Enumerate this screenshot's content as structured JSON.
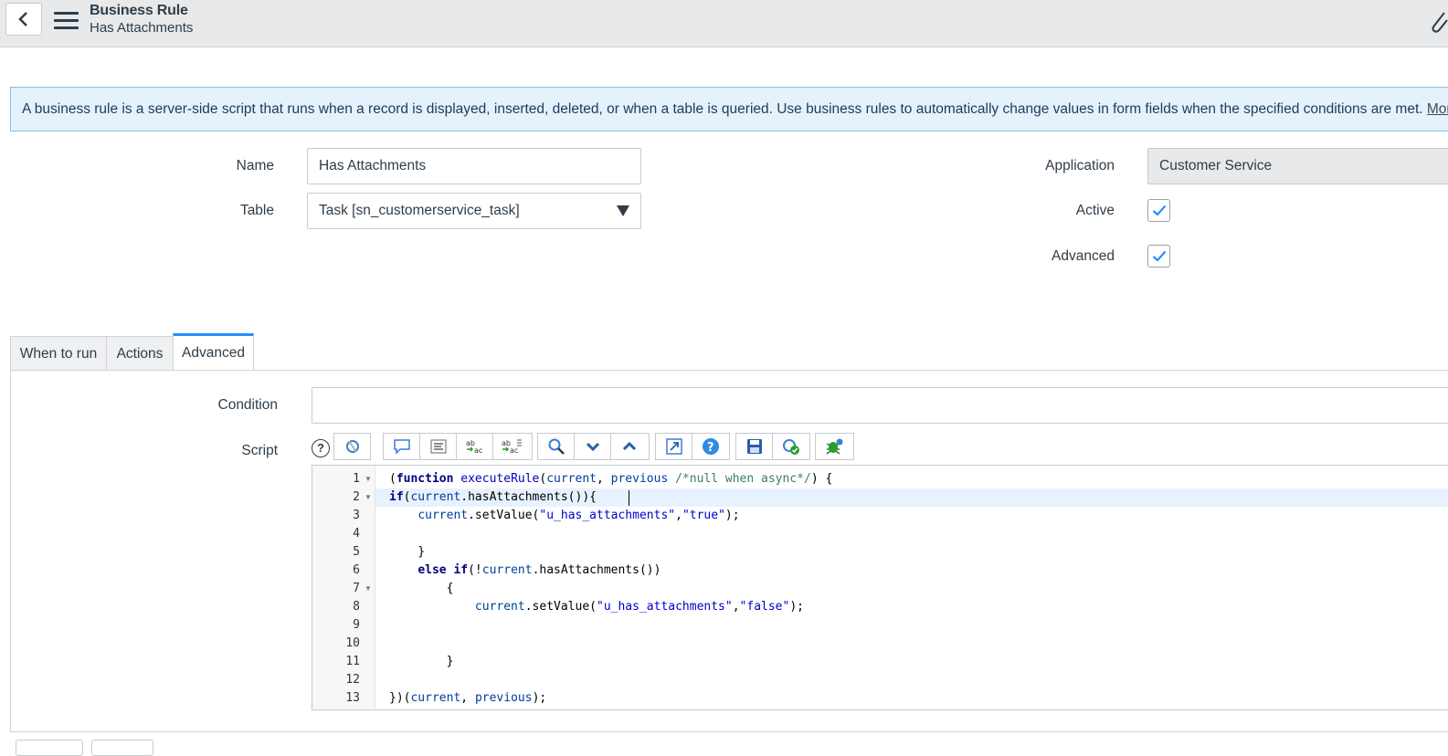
{
  "header": {
    "title": "Business Rule",
    "subtitle": "Has Attachments"
  },
  "info": {
    "text": "A business rule is a server-side script that runs when a record is displayed, inserted, deleted, or when a table is queried. Use business rules to automatically change values in form fields when the specified conditions are met. ",
    "link": "More Info"
  },
  "form": {
    "name_label": "Name",
    "name_value": "Has Attachments",
    "table_label": "Table",
    "table_value": "Task [sn_customerservice_task]",
    "application_label": "Application",
    "application_value": "Customer Service",
    "active_label": "Active",
    "active_checked": true,
    "advanced_label": "Advanced",
    "advanced_checked": true
  },
  "tabs": [
    {
      "label": "When to run"
    },
    {
      "label": "Actions"
    },
    {
      "label": "Advanced",
      "active": true
    }
  ],
  "advanced": {
    "condition_label": "Condition",
    "condition_value": "",
    "script_label": "Script"
  },
  "toolbar_icons": [
    "script-include-icon",
    "comment-icon",
    "format-icon",
    "replace-icon",
    "replace-all-icon",
    "search-icon",
    "find-next-icon",
    "find-previous-icon",
    "fullscreen-icon",
    "help-icon",
    "save-icon",
    "script-check-icon",
    "debug-icon"
  ],
  "code": {
    "line_numbers": [
      "1",
      "2",
      "3",
      "4",
      "5",
      "6",
      "7",
      "8",
      "9",
      "10",
      "11",
      "12",
      "13"
    ],
    "lines": [
      "(function executeRule(current, previous /*null when async*/) {",
      "if(current.hasAttachments()){",
      "    current.setValue(\"u_has_attachments\",\"true\");",
      "",
      "    }",
      "    else if(!current.hasAttachments())",
      "        {",
      "            current.setValue(\"u_has_attachments\",\"false\");",
      "",
      "",
      "        }",
      "",
      "})(current, previous);"
    ]
  },
  "colors": {
    "accent": "#278efc",
    "info_bg": "#e5f2fb",
    "header_bg": "#e7e9eb"
  }
}
